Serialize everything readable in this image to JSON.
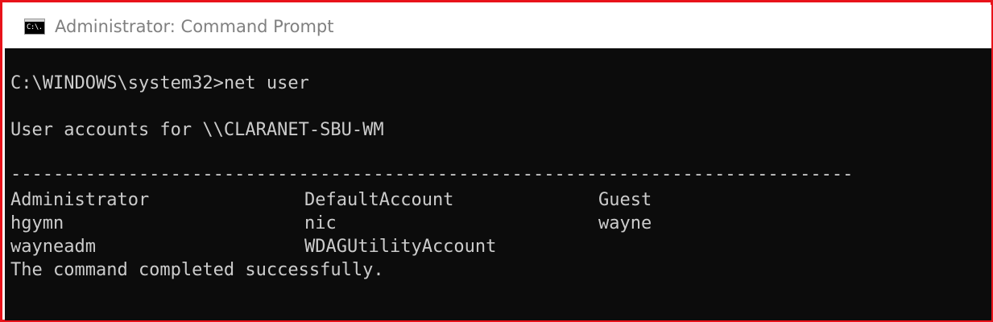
{
  "window": {
    "title": "Administrator: Command Prompt",
    "icon": "cmd-icon",
    "icon_text": "C:\\."
  },
  "console": {
    "prompt_line": "C:\\WINDOWS\\system32>net user",
    "header_line": "User accounts for \\\\CLARANET-SBU-WM",
    "separator": "-------------------------------------------------------------------------------",
    "accounts": [
      [
        "Administrator",
        "DefaultAccount",
        "Guest"
      ],
      [
        "hgymn",
        "nic",
        "wayne"
      ],
      [
        "wayneadm",
        "WDAGUtilityAccount",
        ""
      ]
    ],
    "result_line": "The command completed successfully."
  },
  "colors": {
    "frame_border": "#e8121a",
    "console_bg": "#0c0c0c",
    "console_text": "#cccccc",
    "title_text": "#808080"
  }
}
